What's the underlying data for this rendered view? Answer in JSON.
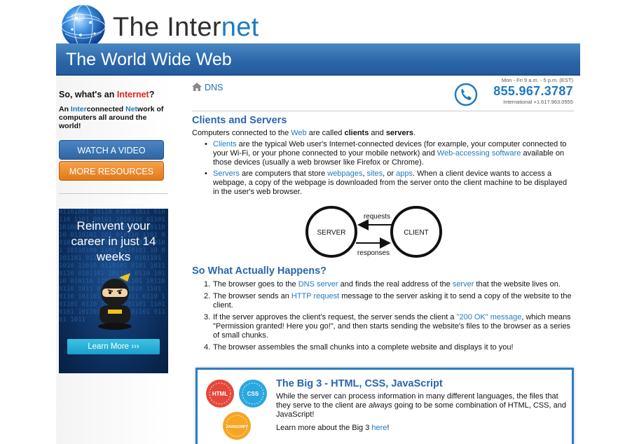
{
  "logo": {
    "text_main": "The Inter",
    "text_accent": "net"
  },
  "banner": {
    "title": "The World Wide Web"
  },
  "sidebar": {
    "question_prefix": "So, what's an ",
    "question_highlight": "Internet",
    "question_suffix": "?",
    "desc_parts": [
      "An ",
      "Inter",
      "connected ",
      "Net",
      "work of computers all around the world!"
    ],
    "buttons": {
      "video": "WATCH A VIDEO",
      "resources": "MORE RESOURCES"
    },
    "ad": {
      "title": "Reinvent your career in just 14 weeks",
      "code_text": "01101001 10110 0110 1011 010110 1101 00101 1010110 01101 10100 1101011 0100 110 1011010 0110101 101 010110 1101 0010110 1011 0110100 1011 0101 10110100 1101 0110101 10 0101101 0110 1011010 0101101 1010 11010 0110101 0101 1011 0110 0101101 101101 0110 10110 010110 1101 0101101 10110 0110 1011 0101 1011010 1101 0110 101101 0101 1011 0110 101101 0110 1011 0101101 1101 0101 1011010 0110 101101 01101 1011",
      "button": "Learn More ›››"
    }
  },
  "breadcrumb": {
    "label": "DNS"
  },
  "contact": {
    "hours": "Mon - Fri 9 a.m. - 5 p.m. (EST)",
    "phone": "855.967.3787",
    "international": "International +1.617.963.0555"
  },
  "section1": {
    "heading": "Clients and Servers",
    "intro_parts": [
      "Computers connected to the ",
      "Web",
      " are called ",
      "clients",
      " and ",
      "servers",
      "."
    ],
    "bullet1": [
      "Clients",
      " are the typical Web user's Internet-connected devices (for example, your computer connected to your Wi-Fi, or your phone connected to your mobile network) and ",
      "Web-accessing software",
      " available on those devices (usually a web browser like Firefox or Chrome)."
    ],
    "bullet2": [
      "Servers",
      " are computers that store ",
      "webpages",
      ", ",
      "sites",
      ", or ",
      "apps",
      ". When a client device wants to access a webpage, a copy of the webpage is downloaded from the server onto the client machine to be displayed in the user's web browser."
    ]
  },
  "diagram": {
    "server": "SERVER",
    "client": "CLIENT",
    "requests": "requests",
    "responses": "responses"
  },
  "section2": {
    "heading": "So What Actually Happens?",
    "steps": [
      [
        "The browser goes to the ",
        "DNS server",
        " and finds the real address of the ",
        "server",
        " that the website lives on."
      ],
      [
        "The browser sends an ",
        "HTTP request",
        " message to the server asking it to send a copy of the website to the client."
      ],
      [
        "If the server approves the client's request, the server sends the client a ",
        "\"200 OK\" message",
        ", which means \"Permission granted! Here you go!\", and then starts sending the website's files to the browser as a series of small chunks."
      ],
      [
        "The browser assembles the small chunks into a complete website and displays it to you!"
      ]
    ]
  },
  "big3": {
    "title": "The Big 3 - HTML, CSS, JavaScript",
    "text_parts": [
      "While the server can process information in many different languages, the files that they serve to the client are ",
      "always",
      " going to be some combination of HTML, CSS, and JavaScript!"
    ],
    "learn_prefix": "Learn more about the Big 3 ",
    "learn_link": "here",
    "learn_suffix": "!",
    "badges": {
      "html": "HTML",
      "css": "CSS",
      "js": "JAVASCRIPT"
    }
  },
  "colors": {
    "brand_blue": "#1f7ac0",
    "banner_blue": "#2a65a8",
    "orange": "#e37a18",
    "red": "#e0231b"
  }
}
